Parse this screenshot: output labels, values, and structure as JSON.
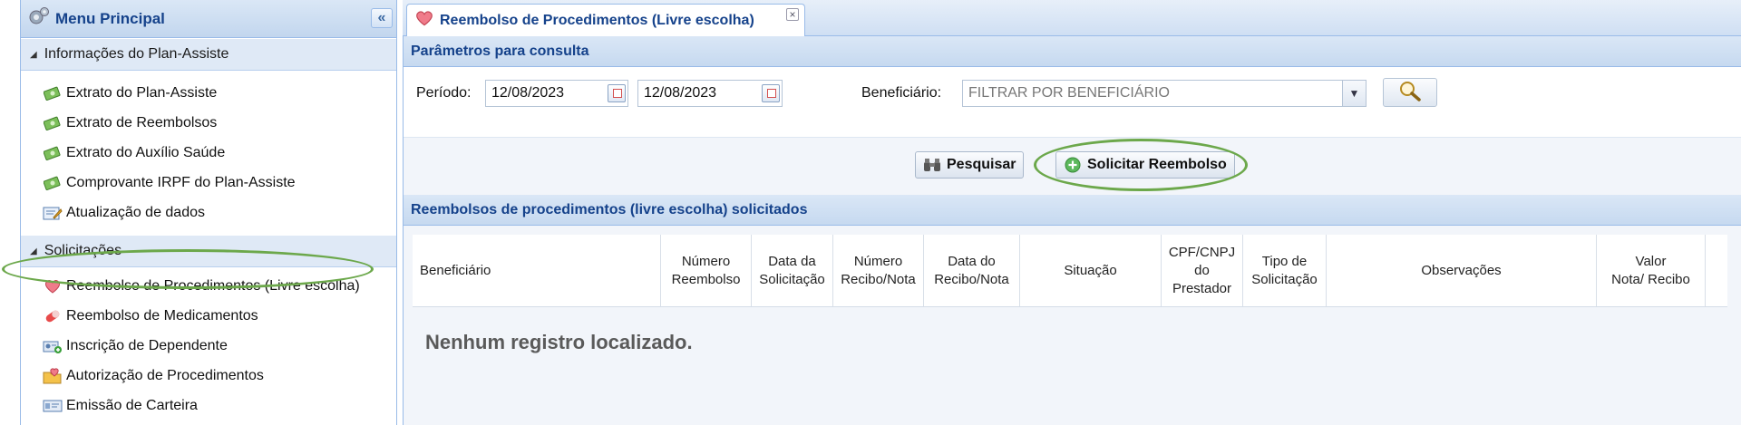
{
  "sidebar": {
    "title": "Menu Principal",
    "collapse_glyph": "«",
    "groups": [
      {
        "label": "Informações do Plan-Assiste",
        "items": [
          {
            "label": "Extrato do Plan-Assiste",
            "icon": "money-icon"
          },
          {
            "label": "Extrato de Reembolsos",
            "icon": "money-icon"
          },
          {
            "label": "Extrato do Auxílio Saúde",
            "icon": "money-icon"
          },
          {
            "label": "Comprovante IRPF do Plan-Assiste",
            "icon": "money-icon"
          },
          {
            "label": "Atualização de dados",
            "icon": "edit-form-icon"
          }
        ]
      },
      {
        "label": "Solicitações",
        "items": [
          {
            "label": "Reembolso de Procedimentos (Livre escolha)",
            "icon": "heart-icon"
          },
          {
            "label": "Reembolso de Medicamentos",
            "icon": "pill-icon"
          },
          {
            "label": "Inscrição de Dependente",
            "icon": "add-user-icon"
          },
          {
            "label": "Autorização de Procedimentos",
            "icon": "folder-heart-icon"
          },
          {
            "label": "Emissão de Carteira",
            "icon": "id-card-icon"
          }
        ]
      }
    ]
  },
  "tab": {
    "label": "Reembolso de Procedimentos (Livre escolha)",
    "close_glyph": "×"
  },
  "params": {
    "title": "Parâmetros para consulta",
    "periodo_label": "Período:",
    "date_from": "12/08/2023",
    "date_to": "12/08/2023",
    "beneficiario_label": "Beneficiário:",
    "beneficiario_placeholder": "FILTRAR POR BENEFICIÁRIO"
  },
  "buttons": {
    "pesquisar": "Pesquisar",
    "solicitar": "Solicitar Reembolso"
  },
  "grid": {
    "title": "Reembolsos de procedimentos (livre escolha) solicitados",
    "columns": [
      "Beneficiário",
      "Número\nReembolso",
      "Data da\nSolicitação",
      "Número\nRecibo/Nota",
      "Data do\nRecibo/Nota",
      "Situação",
      "CPF/CNPJ\ndo\nPrestador",
      "Tipo de\nSolicitação",
      "Observações",
      "Valor\nNota/ Recibo"
    ],
    "empty_text": "Nenhum registro localizado."
  },
  "colors": {
    "header_blue": "#15428b",
    "highlight_green": "#6ca84b",
    "panel_border": "#99bbe8"
  }
}
